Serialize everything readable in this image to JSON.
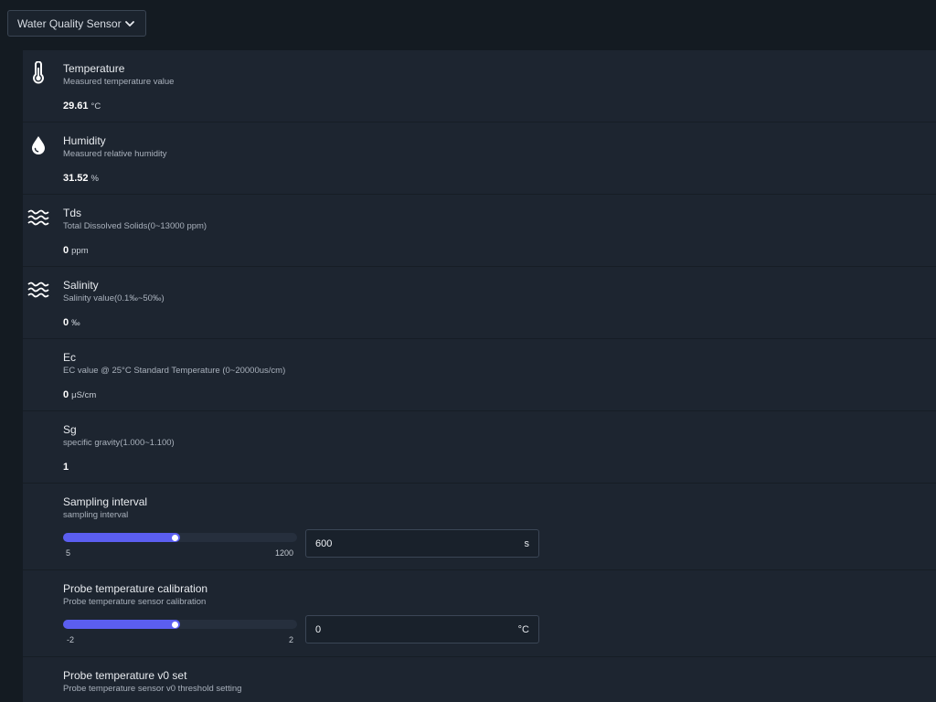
{
  "device_select": {
    "label": "Water Quality Sensor"
  },
  "sensors": [
    {
      "title": "Temperature",
      "desc": "Measured temperature value",
      "value": "29.61",
      "unit": "°C",
      "icon": "thermometer-icon"
    },
    {
      "title": "Humidity",
      "desc": "Measured relative humidity",
      "value": "31.52",
      "unit": "%",
      "icon": "water-drop-icon"
    },
    {
      "title": "Tds",
      "desc": "Total Dissolved Solids(0~13000 ppm)",
      "value": "0",
      "unit": "ppm",
      "icon": "waves-icon"
    },
    {
      "title": "Salinity",
      "desc": "Salinity value(0.1‰~50‰)",
      "value": "0",
      "unit": "‰",
      "icon": "waves-icon"
    },
    {
      "title": "Ec",
      "desc": "EC value @ 25°C Standard Temperature (0~20000us/cm)",
      "value": "0",
      "unit": "μS/cm"
    },
    {
      "title": "Sg",
      "desc": "specific gravity(1.000~1.100)",
      "value": "1",
      "unit": ""
    }
  ],
  "settings": [
    {
      "title": "Sampling interval",
      "desc": "sampling interval",
      "min_label": "5",
      "max_label": "1200",
      "input_value": "600",
      "unit": "s",
      "slider_fraction": 0.5
    },
    {
      "title": "Probe temperature calibration",
      "desc": "Probe temperature sensor calibration",
      "min_label": "-2",
      "max_label": "2",
      "input_value": "0",
      "unit": "°C",
      "slider_fraction": 0.5
    },
    {
      "title": "Probe temperature v0 set",
      "desc": "Probe temperature sensor v0 threshold setting"
    }
  ],
  "colors": {
    "accent": "#5b5ef0",
    "background": "#141b22",
    "panel": "#1d2530"
  }
}
